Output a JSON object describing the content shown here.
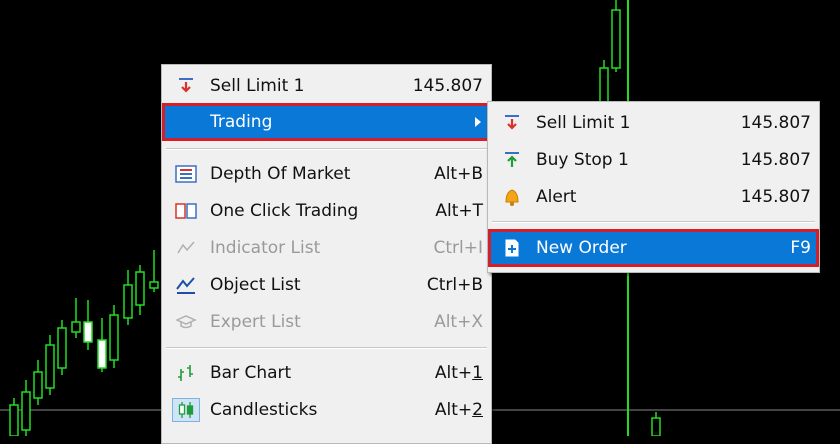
{
  "main_menu": {
    "items": [
      {
        "label": "Sell Limit 1",
        "shortcut": "145.807",
        "icon": "sell-limit-icon"
      },
      {
        "label": "Trading",
        "shortcut": "",
        "icon": "none"
      },
      {
        "label": "Depth Of Market",
        "shortcut": "Alt+B",
        "icon": "depth-of-market-icon"
      },
      {
        "label": "One Click Trading",
        "shortcut": "Alt+T",
        "icon": "one-click-trading-icon"
      },
      {
        "label": "Indicator List",
        "shortcut": "Ctrl+I",
        "icon": "indicator-list-icon"
      },
      {
        "label": "Object List",
        "shortcut": "Ctrl+B",
        "icon": "object-list-icon"
      },
      {
        "label": "Expert List",
        "shortcut": "Alt+X",
        "icon": "expert-list-icon"
      },
      {
        "label": "Bar Chart",
        "shortcut_prefix": "Alt+",
        "shortcut_key": "1",
        "icon": "bar-chart-icon"
      },
      {
        "label": "Candlesticks",
        "shortcut_prefix": "Alt+",
        "shortcut_key": "2",
        "icon": "candlesticks-icon"
      }
    ]
  },
  "sub_menu": {
    "items": [
      {
        "label": "Sell Limit 1",
        "shortcut": "145.807",
        "icon": "sell-limit-icon"
      },
      {
        "label": "Buy Stop 1",
        "shortcut": "145.807",
        "icon": "buy-stop-icon"
      },
      {
        "label": "Alert",
        "shortcut": "145.807",
        "icon": "bell-icon"
      },
      {
        "label": "New Order",
        "shortcut": "F9",
        "icon": "new-order-icon"
      }
    ]
  },
  "colors": {
    "highlight": "#0a78d7",
    "highlight_border": "#d21f2b",
    "candle": "#22dd22"
  }
}
